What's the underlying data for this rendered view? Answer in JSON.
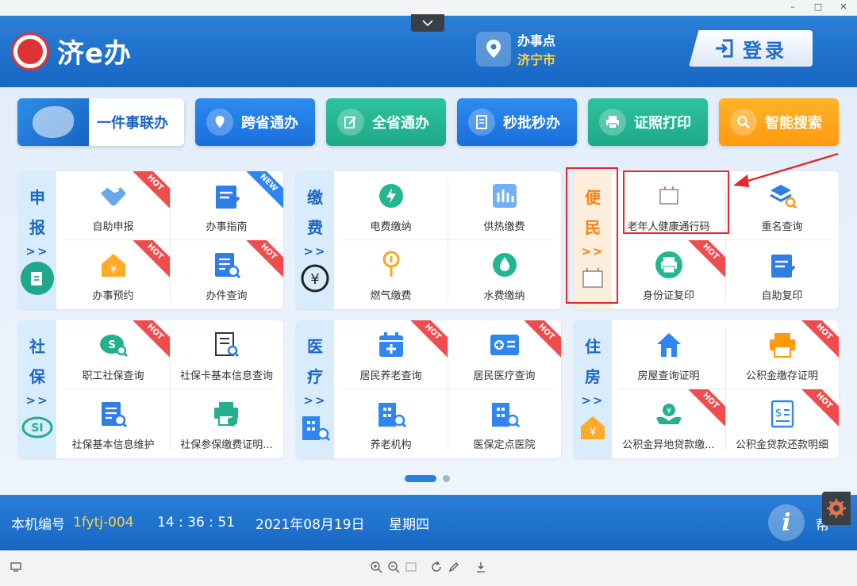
{
  "window": {
    "min": "–",
    "max": "□",
    "close": "✕"
  },
  "header": {
    "logo_text": "济e办",
    "place_label": "办事点",
    "place_city": "济宁市",
    "login_label": "登录"
  },
  "topnav": [
    {
      "label": "一件事联办",
      "icon": "map-icon"
    },
    {
      "label": "跨省通办",
      "icon": "map-pin-icon"
    },
    {
      "label": "全省通办",
      "icon": "edit-icon"
    },
    {
      "label": "秒批秒办",
      "icon": "document-icon"
    },
    {
      "label": "证照打印",
      "icon": "printer-icon"
    },
    {
      "label": "智能搜索",
      "icon": "search-icon"
    }
  ],
  "panels": {
    "shenbao": {
      "title1": "申",
      "title2": "报",
      "arrow": ">>",
      "items": [
        "自助申报",
        "办事指南",
        "办事预约",
        "办件查询"
      ]
    },
    "jiaofei": {
      "title1": "缴",
      "title2": "费",
      "arrow": ">>",
      "items": [
        "电费缴纳",
        "供热缴费",
        "燃气缴费",
        "水费缴纳"
      ]
    },
    "bianmin": {
      "title1": "便",
      "title2": "民",
      "arrow": ">>",
      "items": [
        "老年人健康通行码",
        "重名查询",
        "身份证复印",
        "自助复印"
      ]
    },
    "shebao": {
      "title1": "社",
      "title2": "保",
      "arrow": ">>",
      "items": [
        "职工社保查询",
        "社保卡基本信息查询",
        "社保基本信息维护",
        "社保参保缴费证明..."
      ]
    },
    "yiliao": {
      "title1": "医",
      "title2": "疗",
      "arrow": ">>",
      "items": [
        "居民养老查询",
        "居民医疗查询",
        "养老机构",
        "医保定点医院"
      ]
    },
    "zhufang": {
      "title1": "住",
      "title2": "房",
      "arrow": ">>",
      "items": [
        "房屋查询证明",
        "公积金缴存证明",
        "公积金异地贷款缴...",
        "公积金贷款还款明细"
      ]
    }
  },
  "badges": {
    "hot": "HOT",
    "new": "NEW"
  },
  "footer": {
    "machine_label": "本机编号",
    "machine_id": "1fytj-004",
    "time": "14 : 36 : 51",
    "date": "2021年08月19日",
    "weekday": "星期四",
    "info": "i",
    "help": "帮"
  },
  "colors": {
    "brand_blue": "#1767c4",
    "accent_yellow": "#ffd23a",
    "hot_red": "#f24b4b",
    "highlight_red": "#e8272b"
  }
}
